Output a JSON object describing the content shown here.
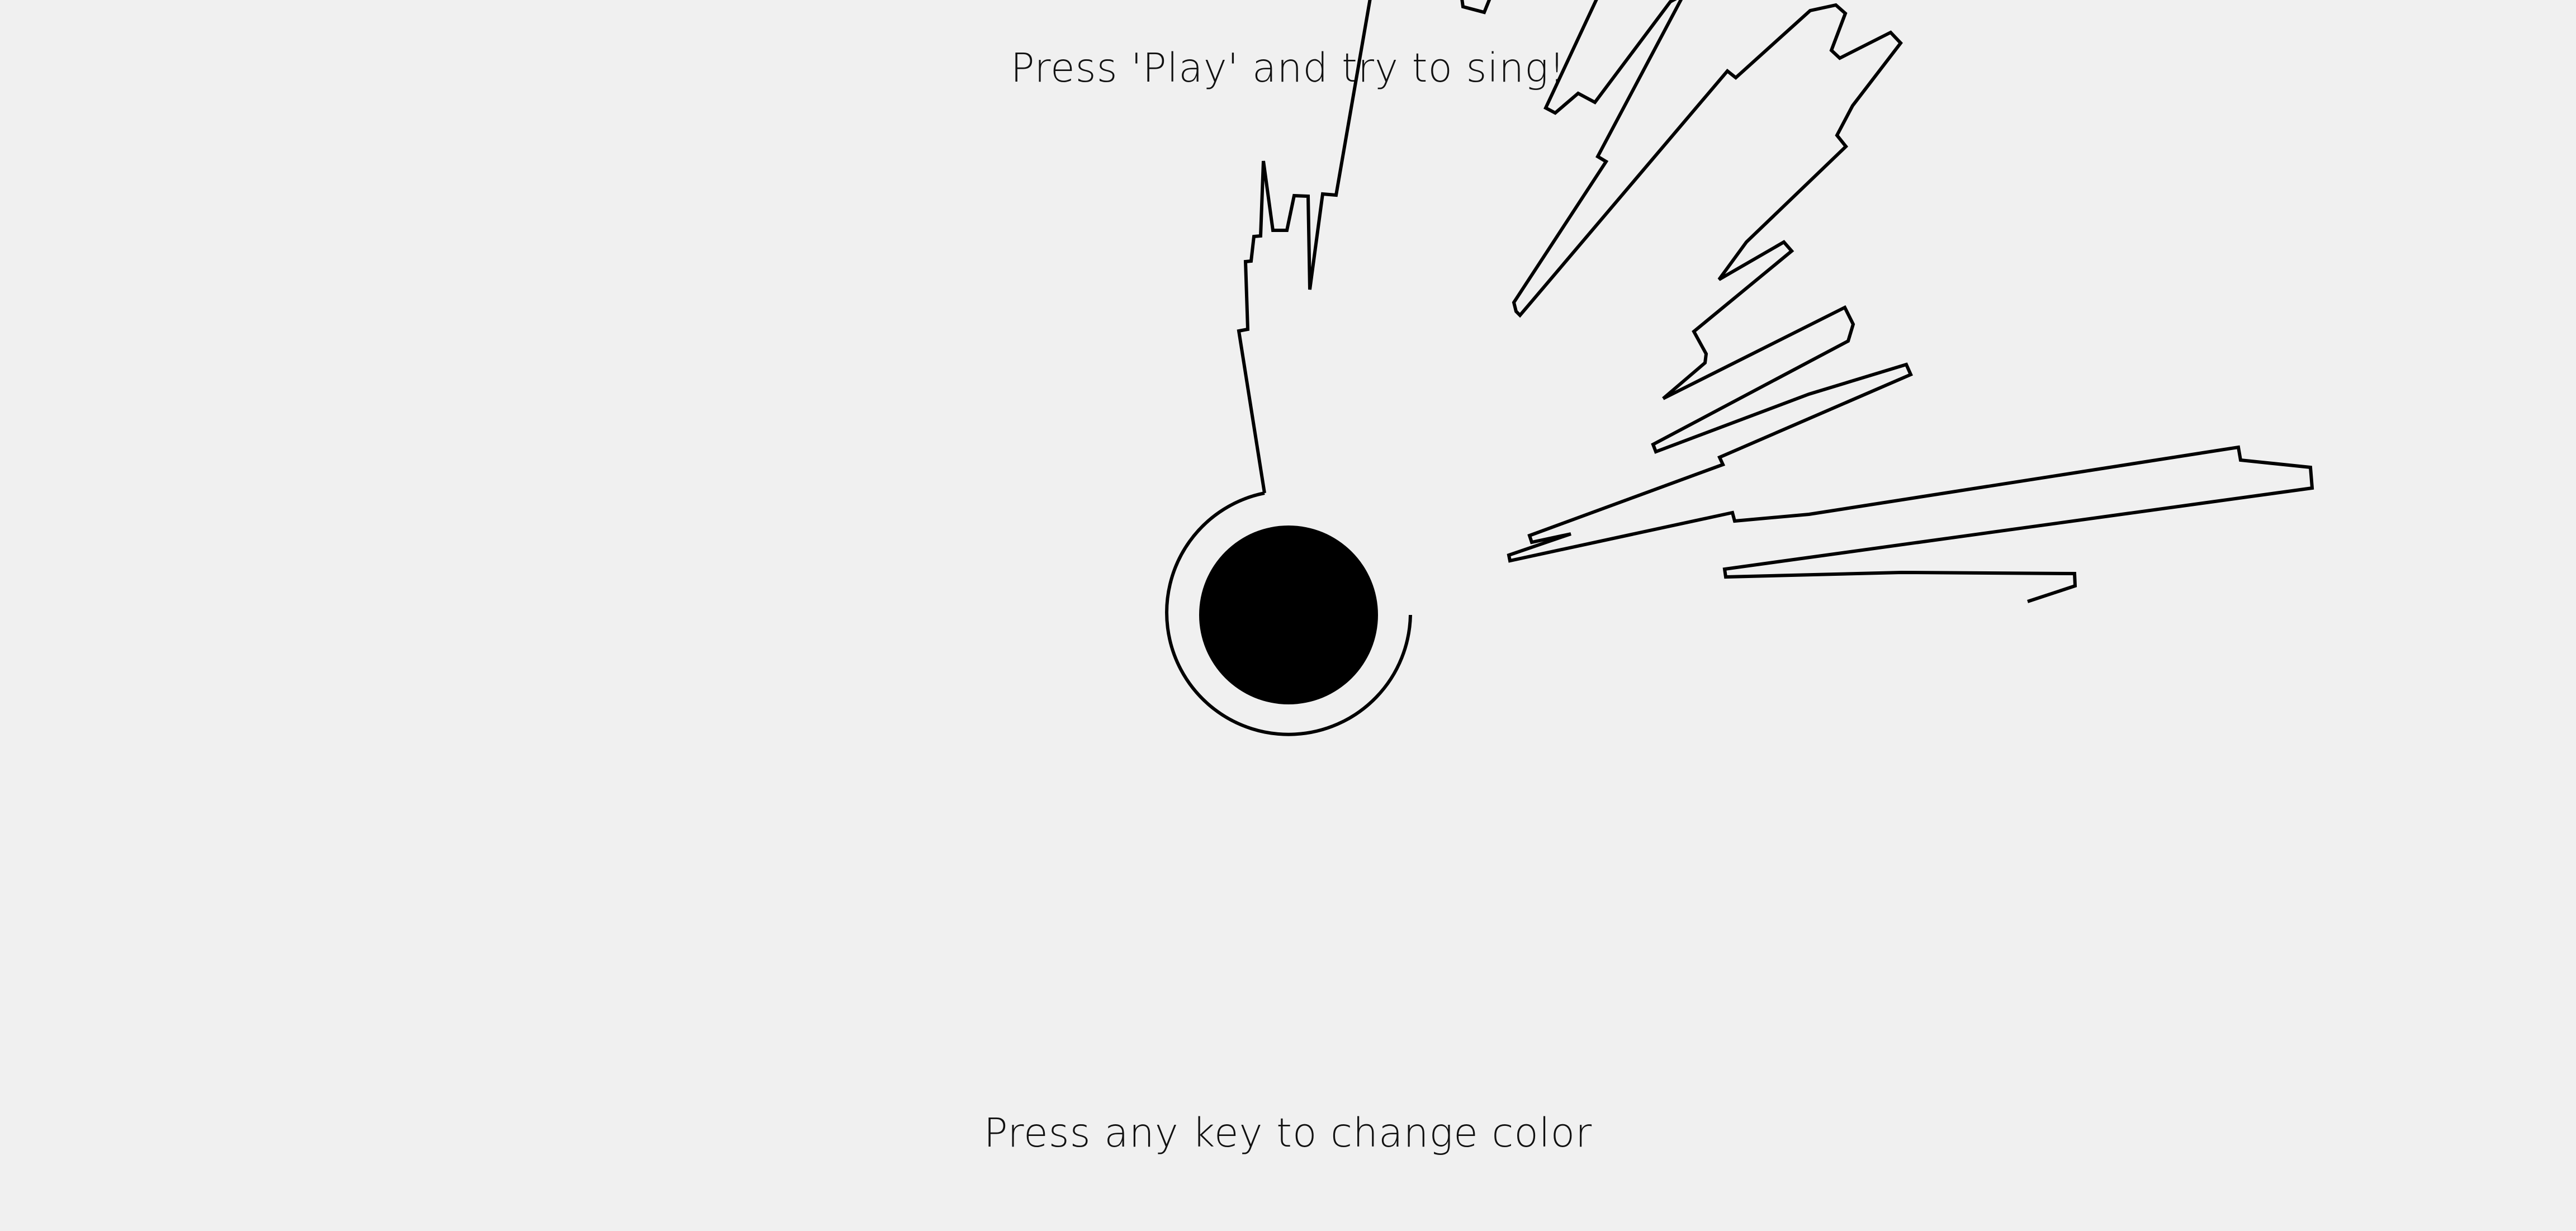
{
  "instructions": {
    "top": "Press 'Play' and try to sing!",
    "bottom": "Press any key to change color"
  },
  "colors": {
    "background": "#f0f0f0",
    "stroke": "#000000",
    "center_fill": "#000000",
    "text": "#111111"
  }
}
